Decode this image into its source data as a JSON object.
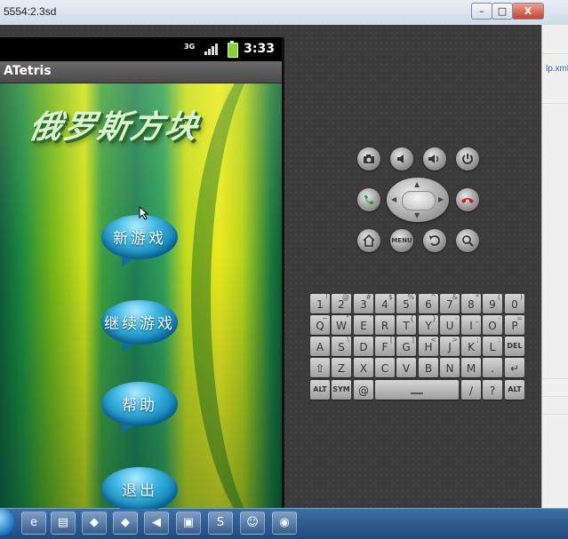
{
  "window": {
    "title": "5554:2.3sd",
    "min": "–",
    "max": "□",
    "close": "X"
  },
  "ide": {
    "file": "lp.xml"
  },
  "statusbar": {
    "network": "3G",
    "time": "3:33"
  },
  "app": {
    "title": "ATetris",
    "game_title": "俄罗斯方块"
  },
  "menu": [
    {
      "label": "新游戏"
    },
    {
      "label": "继续游戏"
    },
    {
      "label": "帮助"
    },
    {
      "label": "退出"
    }
  ],
  "hw": {
    "camera": "camera-icon",
    "vol_down": "volume-down-icon",
    "vol_up": "volume-up-icon",
    "power": "power-icon",
    "call": "call-icon",
    "end": "end-call-icon",
    "home": "home-icon",
    "menu": "MENU",
    "back": "back-icon",
    "search": "search-icon"
  },
  "keyboard": {
    "row1": [
      [
        "1",
        "!"
      ],
      [
        "2",
        "@"
      ],
      [
        "3",
        "#"
      ],
      [
        "4",
        "$"
      ],
      [
        "5",
        "%"
      ],
      [
        "6",
        "^"
      ],
      [
        "7",
        "&"
      ],
      [
        "8",
        "*"
      ],
      [
        "9",
        "("
      ],
      [
        "0",
        ")"
      ]
    ],
    "row2": [
      [
        "Q",
        "~"
      ],
      [
        "W",
        "\""
      ],
      [
        "E",
        "'"
      ],
      [
        "R",
        ""
      ],
      [
        "T",
        "{"
      ],
      [
        "Y",
        "}"
      ],
      [
        "U",
        "-"
      ],
      [
        "I",
        "_"
      ],
      [
        "O",
        "-"
      ],
      [
        "P",
        "="
      ]
    ],
    "row3": [
      [
        "A",
        ""
      ],
      [
        "S",
        "\\"
      ],
      [
        "D",
        ""
      ],
      [
        "F",
        "["
      ],
      [
        "G",
        "]"
      ],
      [
        "H",
        "<"
      ],
      [
        "J",
        ">"
      ],
      [
        "K",
        ";"
      ],
      [
        "L",
        ":"
      ]
    ],
    "row4": [
      [
        "Z",
        ""
      ],
      [
        "X",
        ""
      ],
      [
        "C",
        ""
      ],
      [
        "V",
        ""
      ],
      [
        "B",
        ""
      ],
      [
        "N",
        ""
      ],
      [
        "M",
        ""
      ],
      [
        ".",
        ""
      ]
    ],
    "row5_alt": "ALT",
    "row5_sym": "SYM",
    "row5_at": "@",
    "row5_slash": "/",
    "row5_q": "?",
    "row5_alt2": "ALT",
    "del": "DEL"
  },
  "taskbar": [
    "e",
    "▤",
    "◆",
    "◆",
    "◀",
    "▣",
    "S",
    "☺",
    "◉"
  ]
}
